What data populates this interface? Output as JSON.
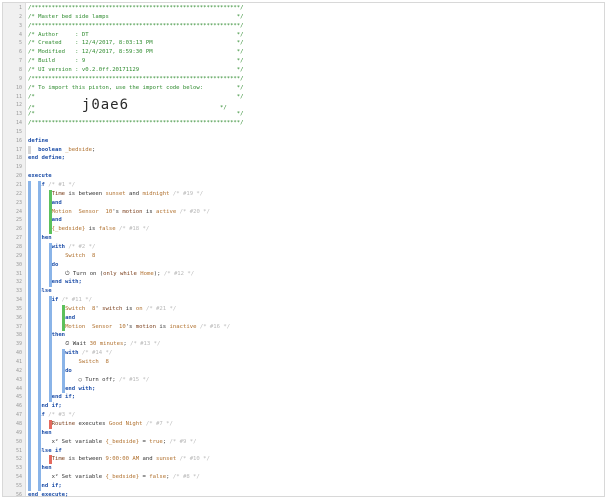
{
  "editor": {
    "lines": [
      {
        "n": "1",
        "segments": [
          {
            "t": "/**************************************************************/",
            "c": "c-green"
          }
        ]
      },
      {
        "n": "2",
        "segments": [
          {
            "t": "/* Master bed side lamps                                      */",
            "c": "c-green"
          }
        ]
      },
      {
        "n": "3",
        "segments": [
          {
            "t": "/**************************************************************/",
            "c": "c-green"
          }
        ]
      },
      {
        "n": "4",
        "segments": [
          {
            "t": "/* Author     : DT                                            */",
            "c": "c-green"
          }
        ]
      },
      {
        "n": "5",
        "segments": [
          {
            "t": "/* Created    : 12/4/2017, 8:03:13 PM                         */",
            "c": "c-green"
          }
        ]
      },
      {
        "n": "6",
        "segments": [
          {
            "t": "/* Modified   : 12/4/2017, 8:59:30 PM                         */",
            "c": "c-green"
          }
        ]
      },
      {
        "n": "7",
        "segments": [
          {
            "t": "/* Build      : 9                                             */",
            "c": "c-green"
          }
        ]
      },
      {
        "n": "8",
        "segments": [
          {
            "t": "/* UI version : v0.2.0ff.20171129                             */",
            "c": "c-green"
          }
        ]
      },
      {
        "n": "9",
        "segments": [
          {
            "t": "/**************************************************************/",
            "c": "c-green"
          }
        ]
      },
      {
        "n": "10",
        "segments": [
          {
            "t": "/* To import this piston, use the import code below:          */",
            "c": "c-green"
          }
        ]
      },
      {
        "n": "11",
        "segments": [
          {
            "t": "/*                                                            */",
            "c": "c-green"
          }
        ]
      },
      {
        "n": "12",
        "segments": [
          {
            "t": "/*              ",
            "c": "c-green"
          },
          {
            "t": "j0ae6",
            "c": "big"
          },
          {
            "t": "                           */",
            "c": "c-green"
          }
        ]
      },
      {
        "n": "13",
        "segments": [
          {
            "t": "/*                                                            */",
            "c": "c-green"
          }
        ]
      },
      {
        "n": "14",
        "segments": [
          {
            "t": "/**************************************************************/",
            "c": "c-green"
          }
        ]
      },
      {
        "n": "15",
        "segments": []
      },
      {
        "n": "16",
        "segments": [
          {
            "t": "define",
            "c": "c-kw"
          }
        ]
      },
      {
        "n": "17",
        "indent": 3,
        "segments": [
          {
            "t": "boolean ",
            "c": "c-kw"
          },
          {
            "t": "_bedside",
            "c": "c-var"
          },
          {
            "t": ";"
          }
        ]
      },
      {
        "n": "18",
        "segments": [
          {
            "t": "end define;",
            "c": "c-kw"
          }
        ]
      },
      {
        "n": "19",
        "segments": []
      },
      {
        "n": "20",
        "segments": [
          {
            "t": "execute",
            "c": "c-kw"
          }
        ]
      },
      {
        "n": "21",
        "indent": 3,
        "segments": [
          {
            "t": "if",
            "c": "c-kw"
          },
          {
            "t": " /* #1 */",
            "c": "c-cmt"
          }
        ]
      },
      {
        "n": "22",
        "indent": 7,
        "segments": [
          {
            "t": "Time ",
            "c": "c-attr"
          },
          {
            "t": "is between "
          },
          {
            "t": "sunset",
            "c": "c-val"
          },
          {
            "t": " and "
          },
          {
            "t": "midnight",
            "c": "c-val"
          },
          {
            "t": " /* #19 */",
            "c": "c-cmt"
          }
        ]
      },
      {
        "n": "23",
        "indent": 7,
        "segments": [
          {
            "t": "and",
            "c": "c-kw"
          }
        ]
      },
      {
        "n": "24",
        "indent": 7,
        "segments": [
          {
            "t": "Motion  Sensor  10",
            "c": "c-dev"
          },
          {
            "t": "'s "
          },
          {
            "t": "motion",
            "c": "c-attr"
          },
          {
            "t": " is "
          },
          {
            "t": "active",
            "c": "c-val"
          },
          {
            "t": " /* #20 */",
            "c": "c-cmt"
          }
        ]
      },
      {
        "n": "25",
        "indent": 7,
        "segments": [
          {
            "t": "and",
            "c": "c-kw"
          }
        ]
      },
      {
        "n": "26",
        "indent": 7,
        "segments": [
          {
            "t": "{_bedside}",
            "c": "c-var"
          },
          {
            "t": " is "
          },
          {
            "t": "false",
            "c": "c-val"
          },
          {
            "t": " /* #18 */",
            "c": "c-cmt"
          }
        ]
      },
      {
        "n": "27",
        "indent": 3,
        "segments": [
          {
            "t": "then",
            "c": "c-kw"
          }
        ]
      },
      {
        "n": "28",
        "indent": 7,
        "segments": [
          {
            "t": "with",
            "c": "c-kw"
          },
          {
            "t": " /* #2 */",
            "c": "c-cmt"
          }
        ]
      },
      {
        "n": "29",
        "indent": 11,
        "segments": [
          {
            "t": "Switch  8",
            "c": "c-dev"
          }
        ]
      },
      {
        "n": "30",
        "indent": 7,
        "segments": [
          {
            "t": "do",
            "c": "c-kw"
          }
        ]
      },
      {
        "n": "31",
        "indent": 11,
        "segments": [
          {
            "t": "⏻ Turn on (",
            "c": ""
          },
          {
            "t": "only while",
            "c": "c-attr"
          },
          {
            "t": " "
          },
          {
            "t": "Home",
            "c": "c-val"
          },
          {
            "t": ");"
          },
          {
            "t": " /* #12 */",
            "c": "c-cmt"
          }
        ]
      },
      {
        "n": "32",
        "indent": 7,
        "segments": [
          {
            "t": "end with;",
            "c": "c-kw"
          }
        ]
      },
      {
        "n": "33",
        "indent": 3,
        "segments": [
          {
            "t": "else",
            "c": "c-kw"
          }
        ]
      },
      {
        "n": "34",
        "indent": 7,
        "segments": [
          {
            "t": "if",
            "c": "c-kw"
          },
          {
            "t": " /* #11 */",
            "c": "c-cmt"
          }
        ]
      },
      {
        "n": "35",
        "indent": 11,
        "segments": [
          {
            "t": "Switch  8",
            "c": "c-dev"
          },
          {
            "t": "' "
          },
          {
            "t": "switch",
            "c": "c-attr"
          },
          {
            "t": " is "
          },
          {
            "t": "on",
            "c": "c-val"
          },
          {
            "t": " /* #21 */",
            "c": "c-cmt"
          }
        ]
      },
      {
        "n": "36",
        "indent": 11,
        "segments": [
          {
            "t": "and",
            "c": "c-kw"
          }
        ]
      },
      {
        "n": "37",
        "indent": 11,
        "segments": [
          {
            "t": "Motion  Sensor  10",
            "c": "c-dev"
          },
          {
            "t": "'s "
          },
          {
            "t": "motion",
            "c": "c-attr"
          },
          {
            "t": " is "
          },
          {
            "t": "inactive",
            "c": "c-val"
          },
          {
            "t": " /* #16 */",
            "c": "c-cmt"
          }
        ]
      },
      {
        "n": "38",
        "indent": 7,
        "segments": [
          {
            "t": "then",
            "c": "c-kw"
          }
        ]
      },
      {
        "n": "39",
        "indent": 11,
        "segments": [
          {
            "t": "⏲ Wait "
          },
          {
            "t": "30 minutes",
            "c": "c-val"
          },
          {
            "t": ";"
          },
          {
            "t": " /* #13 */",
            "c": "c-cmt"
          }
        ]
      },
      {
        "n": "40",
        "indent": 11,
        "segments": [
          {
            "t": "with",
            "c": "c-kw"
          },
          {
            "t": " /* #14 */",
            "c": "c-cmt"
          }
        ]
      },
      {
        "n": "41",
        "indent": 15,
        "segments": [
          {
            "t": "Switch  8",
            "c": "c-dev"
          }
        ]
      },
      {
        "n": "42",
        "indent": 11,
        "segments": [
          {
            "t": "do",
            "c": "c-kw"
          }
        ]
      },
      {
        "n": "43",
        "indent": 15,
        "segments": [
          {
            "t": "○ Turn off;"
          },
          {
            "t": " /* #15 */",
            "c": "c-cmt"
          }
        ]
      },
      {
        "n": "44",
        "indent": 11,
        "segments": [
          {
            "t": "end with;",
            "c": "c-kw"
          }
        ]
      },
      {
        "n": "45",
        "indent": 7,
        "segments": [
          {
            "t": "end if;",
            "c": "c-kw"
          }
        ]
      },
      {
        "n": "46",
        "indent": 3,
        "segments": [
          {
            "t": "end if;",
            "c": "c-kw"
          }
        ]
      },
      {
        "n": "47",
        "indent": 3,
        "segments": [
          {
            "t": "if",
            "c": "c-kw"
          },
          {
            "t": " /* #3 */",
            "c": "c-cmt"
          }
        ]
      },
      {
        "n": "48",
        "indent": 7,
        "segments": [
          {
            "t": "Routine",
            "c": "c-attr"
          },
          {
            "t": " executes "
          },
          {
            "t": "Good Night",
            "c": "c-val"
          },
          {
            "t": " /* #7 */",
            "c": "c-cmt"
          }
        ]
      },
      {
        "n": "49",
        "indent": 3,
        "segments": [
          {
            "t": "then",
            "c": "c-kw"
          }
        ]
      },
      {
        "n": "50",
        "indent": 7,
        "segments": [
          {
            "t": "x² Set variable "
          },
          {
            "t": "{_bedside}",
            "c": "c-var"
          },
          {
            "t": " = "
          },
          {
            "t": "true",
            "c": "c-val"
          },
          {
            "t": ";"
          },
          {
            "t": " /* #9 */",
            "c": "c-cmt"
          }
        ]
      },
      {
        "n": "51",
        "indent": 3,
        "segments": [
          {
            "t": "else if",
            "c": "c-kw"
          }
        ]
      },
      {
        "n": "52",
        "indent": 7,
        "segments": [
          {
            "t": "Time ",
            "c": "c-attr"
          },
          {
            "t": "is between "
          },
          {
            "t": "9:00:00 AM",
            "c": "c-val"
          },
          {
            "t": " and "
          },
          {
            "t": "sunset",
            "c": "c-val"
          },
          {
            "t": " /* #10 */",
            "c": "c-cmt"
          }
        ]
      },
      {
        "n": "53",
        "indent": 3,
        "segments": [
          {
            "t": "then",
            "c": "c-kw"
          }
        ]
      },
      {
        "n": "54",
        "indent": 7,
        "segments": [
          {
            "t": "x² Set variable "
          },
          {
            "t": "{_bedside}",
            "c": "c-var"
          },
          {
            "t": " = "
          },
          {
            "t": "false",
            "c": "c-val"
          },
          {
            "t": ";"
          },
          {
            "t": " /* #8 */",
            "c": "c-cmt"
          }
        ]
      },
      {
        "n": "55",
        "indent": 3,
        "segments": [
          {
            "t": "end if;",
            "c": "c-kw"
          }
        ]
      },
      {
        "n": "56",
        "segments": [
          {
            "t": "end execute;",
            "c": "c-kw"
          }
        ]
      }
    ]
  },
  "colors": {
    "comment_banner": "#2e8b2e",
    "keyword": "#1e4fa8",
    "condition_bar_green": "#5cc15c",
    "block_bar_blue": "#8ab4e8",
    "trigger_bar_red": "#e46a5e"
  }
}
